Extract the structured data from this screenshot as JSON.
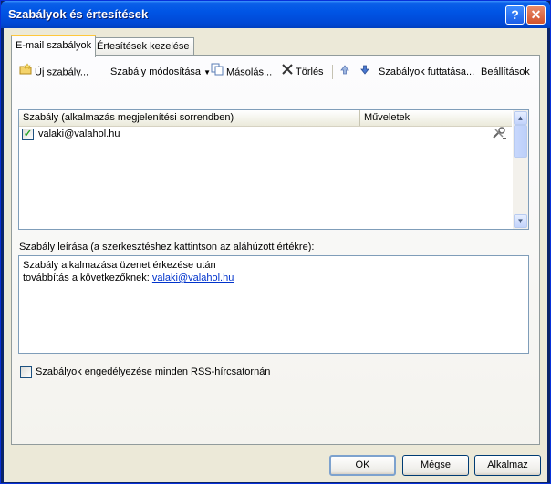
{
  "window": {
    "title": "Szabályok és értesítések"
  },
  "tabs": [
    {
      "label": "E-mail szabályok",
      "active": true
    },
    {
      "label": "Értesítések kezelése",
      "active": false
    }
  ],
  "toolbar": {
    "new_rule": "Új szabály...",
    "modify_rule": "Szabály módosítása",
    "copy": "Másolás...",
    "delete": "Törlés",
    "run_rules": "Szabályok futtatása...",
    "options": "Beállítások"
  },
  "rules_list": {
    "columns": [
      "Szabály (alkalmazás megjelenítési sorrendben)",
      "Műveletek"
    ],
    "rows": [
      {
        "name": "valaki@valahol.hu",
        "checked": true
      }
    ]
  },
  "description": {
    "label": "Szabály leírása (a szerkesztéshez kattintson az aláhúzott értékre):",
    "line1": "Szabály alkalmazása üzenet érkezése után",
    "line2_prefix": "továbbítás a következőknek:",
    "line2_link": "valaki@valahol.hu"
  },
  "rss": {
    "label": "Szabályok engedélyezése minden RSS-hírcsatornán",
    "checked": false
  },
  "buttons": {
    "ok": "OK",
    "cancel": "Mégse",
    "apply": "Alkalmaz"
  },
  "colors": {
    "titlebar": "#0055e5",
    "face": "#ece9d8",
    "link": "#0033cc"
  }
}
